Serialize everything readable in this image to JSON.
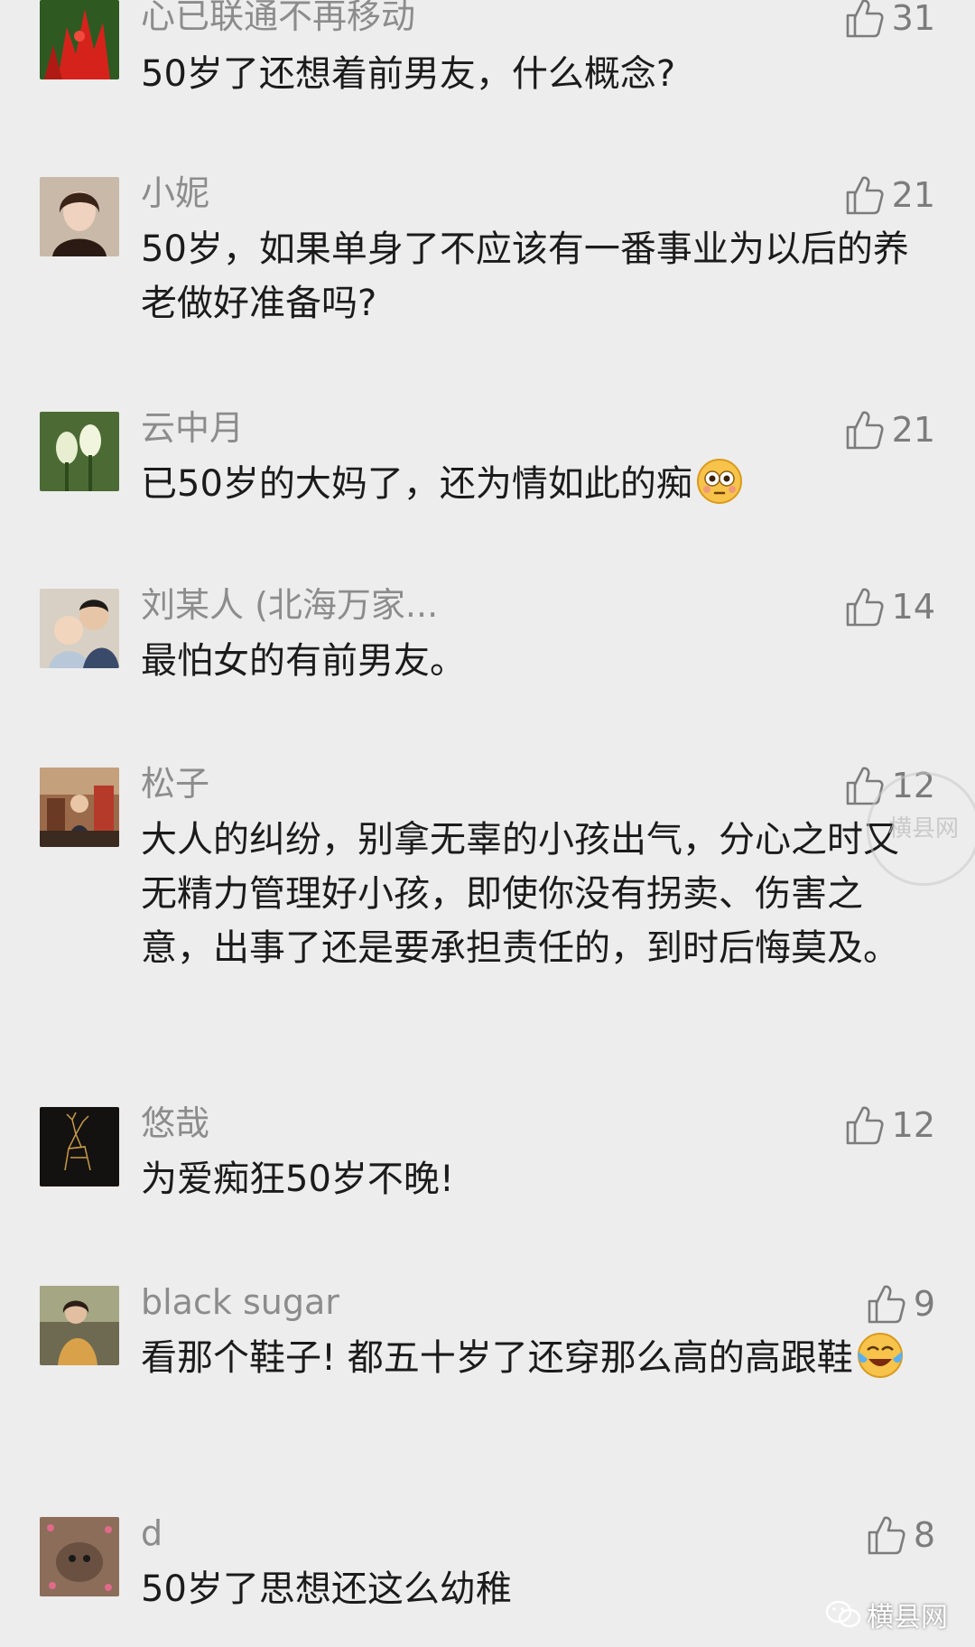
{
  "comments": [
    {
      "user": "心已联通不再移动",
      "likes": "31",
      "text": "50岁了还想着前男友，什么概念?"
    },
    {
      "user": "小妮",
      "likes": "21",
      "text": "50岁，如果单身了不应该有一番事业为以后的养老做好准备吗?"
    },
    {
      "user": "云中月",
      "likes": "21",
      "text": "已50岁的大妈了，还为情如此的痴",
      "emoji": "flushed-face-emoji"
    },
    {
      "user": "刘某人 (北海万家...",
      "likes": "14",
      "text": "最怕女的有前男友。"
    },
    {
      "user": "松子",
      "likes": "12",
      "text": "大人的纠纷，别拿无辜的小孩出气，分心之时又无精力管理好小孩，即使你没有拐卖、伤害之意，出事了还是要承担责任的，到时后悔莫及。"
    },
    {
      "user": "悠哉",
      "likes": "12",
      "text": "为爱痴狂50岁不晚!"
    },
    {
      "user": "black sugar",
      "likes": "9",
      "text": "看那个鞋子! 都五十岁了还穿那么高的高跟鞋",
      "emoji": "crying-laughing-emoji"
    },
    {
      "user": "d",
      "likes": "8",
      "text": "50岁了思想还这么幼稚"
    }
  ],
  "watermark": {
    "stamp_text": "横县网",
    "footer_text": "横县网"
  },
  "colors": {
    "background": "#ededed",
    "username": "#8c8c8c",
    "text": "#1b1b1b",
    "like": "#7c7c7c"
  }
}
